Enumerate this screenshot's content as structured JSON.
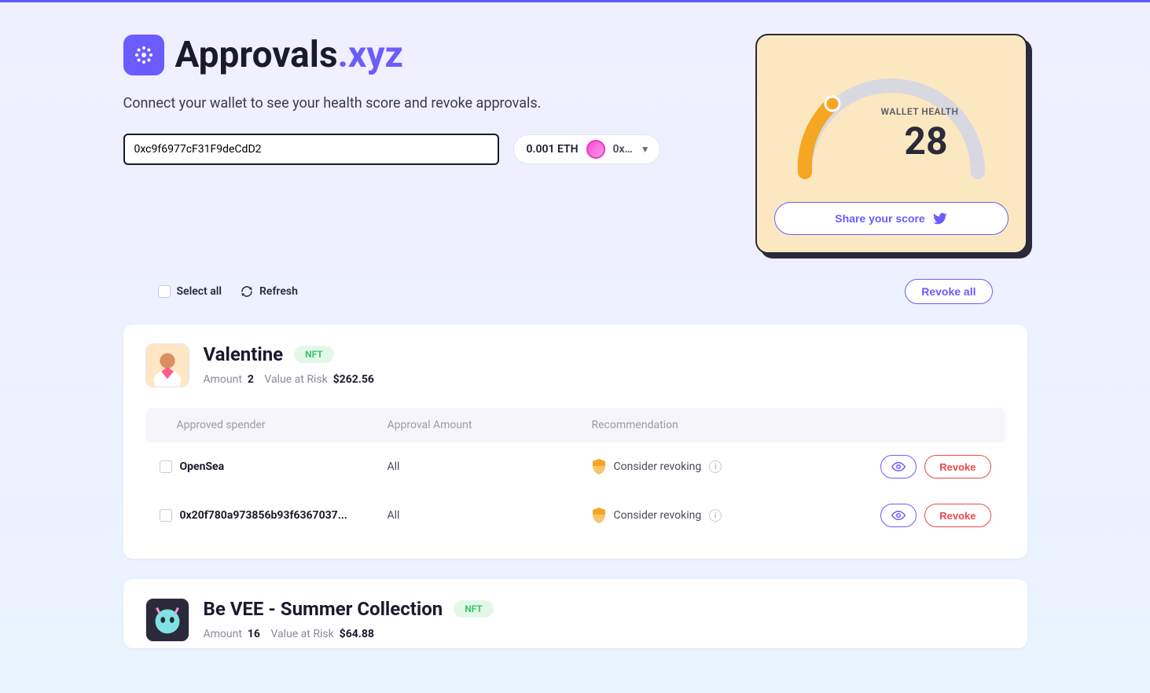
{
  "brand": {
    "name_main": "Approvals",
    "name_suffix": ".xyz"
  },
  "subtitle": "Connect your wallet to see your health score and revoke approvals.",
  "address_input": {
    "value": "0xc9f6977cF31F9deCdD2"
  },
  "wallet": {
    "balance": "0.001 ETH",
    "short_addr": "0x…"
  },
  "health": {
    "label": "WALLET HEALTH",
    "score": "28",
    "share_label": "Share your score"
  },
  "controls": {
    "select_all": "Select all",
    "refresh": "Refresh",
    "revoke_all": "Revoke all"
  },
  "table_headers": {
    "spender": "Approved spender",
    "amount": "Approval Amount",
    "reco": "Recommendation"
  },
  "labels": {
    "amount": "Amount",
    "value_at_risk": "Value at Risk",
    "nft": "NFT",
    "revoke": "Revoke"
  },
  "assets": [
    {
      "name": "Valentine",
      "badge": "NFT",
      "amount": "2",
      "value_at_risk": "$262.56",
      "spenders": [
        {
          "name": "OpenSea",
          "amount": "All",
          "recommendation": "Consider revoking"
        },
        {
          "name": "0x20f780a973856b93f6367037...",
          "amount": "All",
          "recommendation": "Consider revoking"
        }
      ]
    },
    {
      "name": "Be VEE - Summer Collection",
      "badge": "NFT",
      "amount": "16",
      "value_at_risk": "$64.88",
      "spenders": []
    }
  ]
}
